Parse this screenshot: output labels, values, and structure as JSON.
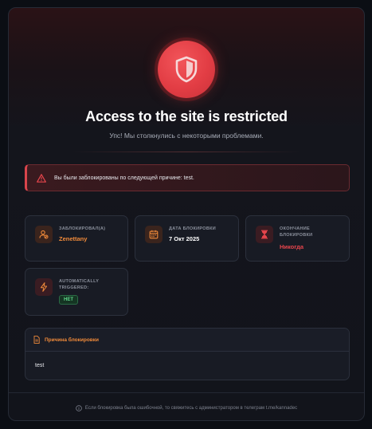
{
  "header": {
    "title": "Access to the site is restricted",
    "subtitle": "Упс! Мы столкнулись с некоторыми проблемами."
  },
  "alert": {
    "text": "Вы были заблокированы по следующей причине: test."
  },
  "cards": {
    "blocked_by": {
      "label": "ЗАБЛОКИРОВАЛ(А)",
      "value": "Zenettany",
      "icon": "user-block-icon"
    },
    "block_date": {
      "label": "ДАТА БЛОКИРОВКИ",
      "value": "7 Окт 2025",
      "icon": "calendar-icon"
    },
    "block_end": {
      "label": "ОКОНЧАНИЕ БЛОКИРОВКИ",
      "value": "Никогда",
      "icon": "hourglass-icon"
    },
    "auto_triggered": {
      "label": "AUTOMATICALLY TRIGGERED:",
      "value": "НЕТ",
      "icon": "lightning-icon"
    }
  },
  "reason": {
    "title": "Причина блокировки",
    "text": "test"
  },
  "footer": {
    "text": "Если блокировка была ошибочной, то свяжитесь с администратором в телеграм t.me/kannadec"
  },
  "colors": {
    "accent_red": "#e23d44",
    "accent_orange": "#f08a3a",
    "success_green": "#5fd38a"
  }
}
